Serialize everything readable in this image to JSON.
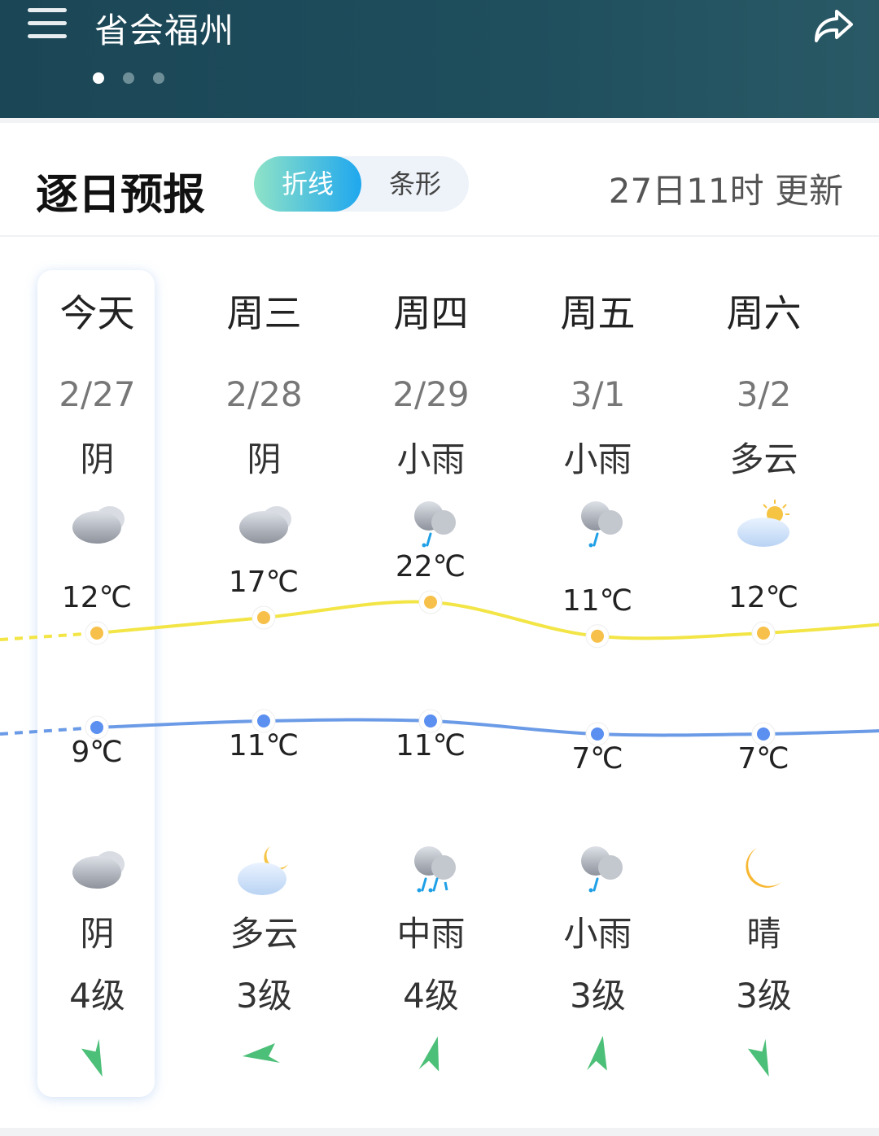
{
  "header": {
    "city": "省会福州",
    "page_dots": 3,
    "active_dot": 0,
    "menu_icon": "menu-icon",
    "share_icon": "share-icon"
  },
  "section": {
    "title": "逐日预报",
    "toggle": [
      {
        "label": "折线",
        "active": true
      },
      {
        "label": "条形",
        "active": false
      }
    ],
    "updated": "27日11时 更新"
  },
  "colors": {
    "high_line": "#f2e545",
    "low_line": "#6b9be6",
    "high_dot": "#f7c04a",
    "low_dot": "#5b8ff0",
    "wind_arrow": "#4cbf78",
    "toggle_start": "#8fe3c7",
    "toggle_end": "#1fa7ee"
  },
  "days": [
    {
      "day": "今天",
      "date": "2/27",
      "day_cond": "阴",
      "day_icon": "overcast",
      "high": "12℃",
      "high_value": 12,
      "low": "9℃",
      "low_value": 9,
      "night_icon": "overcast",
      "night_cond": "阴",
      "wind": "4级",
      "wind_arrow_deg": 165
    },
    {
      "day": "周三",
      "date": "2/28",
      "day_cond": "阴",
      "day_icon": "overcast",
      "high": "17℃",
      "high_value": 17,
      "low": "11℃",
      "low_value": 11,
      "night_icon": "cloudy-night",
      "night_cond": "多云",
      "wind": "3级",
      "wind_arrow_deg": 270
    },
    {
      "day": "周四",
      "date": "2/29",
      "day_cond": "小雨",
      "day_icon": "light-rain",
      "high": "22℃",
      "high_value": 22,
      "low": "11℃",
      "low_value": 11,
      "night_icon": "moderate-rain",
      "night_cond": "中雨",
      "wind": "4级",
      "wind_arrow_deg": 20
    },
    {
      "day": "周五",
      "date": "3/1",
      "day_cond": "小雨",
      "day_icon": "light-rain",
      "high": "11℃",
      "high_value": 11,
      "low": "7℃",
      "low_value": 7,
      "night_icon": "light-rain",
      "night_cond": "小雨",
      "wind": "3级",
      "wind_arrow_deg": 15
    },
    {
      "day": "周六",
      "date": "3/2",
      "day_cond": "多云",
      "day_icon": "partly-cloudy",
      "high": "12℃",
      "high_value": 12,
      "low": "7℃",
      "low_value": 7,
      "night_icon": "clear-night",
      "night_cond": "晴",
      "wind": "3级",
      "wind_arrow_deg": 165
    }
  ]
}
